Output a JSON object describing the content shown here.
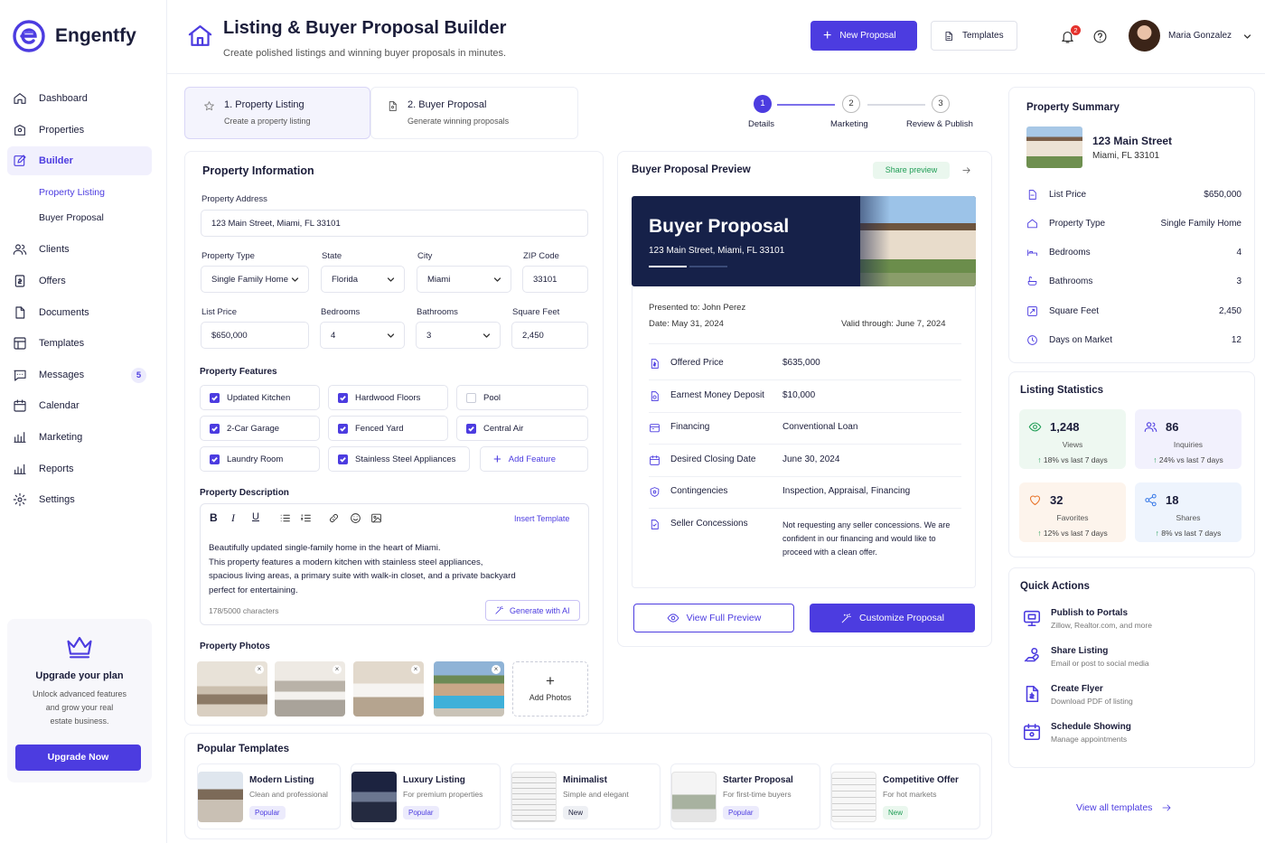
{
  "app": {
    "name": "Engentfy"
  },
  "header": {
    "title": "Listing & Buyer Proposal Builder",
    "subtitle": "Create polished listings and winning buyer proposals in minutes.",
    "new_proposal": "New Proposal",
    "templates": "Templates",
    "notif_count": "2",
    "user_name": "Maria Gonzalez"
  },
  "sidebar": {
    "items": [
      {
        "label": "Dashboard",
        "icon": "home-icon"
      },
      {
        "label": "Properties",
        "icon": "building-icon"
      },
      {
        "label": "Builder",
        "icon": "edit-icon"
      },
      {
        "label": "Property Listing"
      },
      {
        "label": "Buyer Proposal"
      },
      {
        "label": "Clients",
        "icon": "users-icon"
      },
      {
        "label": "Offers",
        "icon": "offer-icon"
      },
      {
        "label": "Documents",
        "icon": "document-icon"
      },
      {
        "label": "Templates",
        "icon": "templates-icon"
      },
      {
        "label": "Messages",
        "icon": "message-icon",
        "badge": "5"
      },
      {
        "label": "Calendar",
        "icon": "calendar-icon"
      },
      {
        "label": "Marketing",
        "icon": "chart-icon"
      },
      {
        "label": "Reports",
        "icon": "reports-icon"
      },
      {
        "label": "Settings",
        "icon": "gear-icon"
      }
    ],
    "upgrade": {
      "title": "Upgrade your plan",
      "line1": "Unlock advanced features",
      "line2": "and grow your real",
      "line3": "estate business.",
      "button": "Upgrade Now"
    }
  },
  "steps_tabs": [
    {
      "title": "1. Property Listing",
      "sub": "Create a property listing"
    },
    {
      "title": "2. Buyer Proposal",
      "sub": "Generate winning proposals"
    }
  ],
  "stepper": [
    {
      "num": "1",
      "label": "Details"
    },
    {
      "num": "2",
      "label": "Marketing"
    },
    {
      "num": "3",
      "label": "Review & Publish"
    }
  ],
  "form": {
    "title": "Property Information",
    "address_label": "Property Address",
    "address": "123 Main Street, Miami, FL 33101",
    "type_label": "Property Type",
    "type": "Single Family Home",
    "state_label": "State",
    "state": "Florida",
    "city_label": "City",
    "city": "Miami",
    "zip_label": "ZIP Code",
    "zip": "33101",
    "price_label": "List Price",
    "price": "$650,000",
    "beds_label": "Bedrooms",
    "beds": "4",
    "baths_label": "Bathrooms",
    "baths": "3",
    "sqft_label": "Square Feet",
    "sqft": "2,450",
    "features_label": "Property Features",
    "features": [
      {
        "label": "Updated Kitchen",
        "checked": true
      },
      {
        "label": "Hardwood Floors",
        "checked": true
      },
      {
        "label": "Pool",
        "checked": false
      },
      {
        "label": "2-Car Garage",
        "checked": true
      },
      {
        "label": "Fenced Yard",
        "checked": true
      },
      {
        "label": "Central Air",
        "checked": true
      },
      {
        "label": "Laundry Room",
        "checked": true
      },
      {
        "label": "Stainless Steel Appliances",
        "checked": true
      }
    ],
    "add_feature": "Add Feature",
    "desc_label": "Property Description",
    "insert_template": "Insert Template",
    "desc_lines": [
      "Beautifully updated single-family home in the heart of Miami.",
      "This property features a modern kitchen with stainless steel appliances,",
      "spacious living areas, a primary suite with walk-in closet, and a private backyard",
      "perfect for entertaining."
    ],
    "char_count": "178/5000 characters",
    "generate_ai": "Generate with AI",
    "photos_label": "Property Photos",
    "add_photos": "Add Photos"
  },
  "proposal": {
    "title": "Buyer Proposal Preview",
    "share": "Share preview",
    "banner_title": "Buyer Proposal",
    "banner_address": "123 Main Street, Miami, FL 33101",
    "presented_to": "Presented to: John Perez",
    "date": "Date:  May 31, 2024",
    "valid": "Valid through: June 7, 2024",
    "rows": [
      {
        "k": "Offered Price",
        "v": "$635,000"
      },
      {
        "k": "Earnest Money Deposit",
        "v": "$10,000"
      },
      {
        "k": "Financing",
        "v": "Conventional Loan"
      },
      {
        "k": "Desired Closing Date",
        "v": "June 30, 2024"
      },
      {
        "k": "Contingencies",
        "v": "Inspection, Appraisal, Financing"
      },
      {
        "k": "Seller Concessions",
        "v1": "Not requesting any seller concessions. We are",
        "v2": "confident in our financing and would like to",
        "v3": "proceed with a clean offer."
      }
    ],
    "view_full": "View Full Preview",
    "customize": "Customize Proposal"
  },
  "summary": {
    "title": "Property Summary",
    "street": "123 Main Street",
    "city": "Miami, FL 33101",
    "rows": [
      {
        "k": "List Price",
        "v": "$650,000"
      },
      {
        "k": "Property Type",
        "v": "Single Family Home"
      },
      {
        "k": "Bedrooms",
        "v": "4"
      },
      {
        "k": "Bathrooms",
        "v": "3"
      },
      {
        "k": "Square Feet",
        "v": "2,450"
      },
      {
        "k": "Days on Market",
        "v": "12"
      }
    ]
  },
  "stats": {
    "title": "Listing Statistics",
    "items": [
      {
        "n": "1,248",
        "l": "Views",
        "d": "18% vs last 7 days",
        "color": "#1f9d55"
      },
      {
        "n": "86",
        "l": "Inquiries",
        "d": "24% vs last 7 days",
        "color": "#4c3ce0"
      },
      {
        "n": "32",
        "l": "Favorites",
        "d": "12% vs last 7 days",
        "color": "#e8742a"
      },
      {
        "n": "18",
        "l": "Shares",
        "d": "8% vs last 7 days",
        "color": "#3b7be8"
      }
    ]
  },
  "quick": {
    "title": "Quick Actions",
    "items": [
      {
        "t": "Publish to Portals",
        "s": "Zillow, Realtor.com, and more"
      },
      {
        "t": "Share Listing",
        "s": "Email or post to social media"
      },
      {
        "t": "Create Flyer",
        "s": "Download PDF of listing"
      },
      {
        "t": "Schedule Showing",
        "s": "Manage appointments"
      }
    ]
  },
  "popular": {
    "title": "Popular Templates",
    "items": [
      {
        "t": "Modern Listing",
        "s": "Clean and professional",
        "b": "Popular"
      },
      {
        "t": "Luxury Listing",
        "s": "For premium properties",
        "b": "Popular"
      },
      {
        "t": "Minimalist",
        "s": "Simple and elegant",
        "b": "New"
      },
      {
        "t": "Starter Proposal",
        "s": "For first-time buyers",
        "b": "Popular"
      },
      {
        "t": "Competitive Offer",
        "s": "For hot markets",
        "b": "New"
      }
    ],
    "view_all": "View all templates"
  },
  "colors": {
    "accent": "#4c3ce0",
    "navy": "#162149"
  }
}
